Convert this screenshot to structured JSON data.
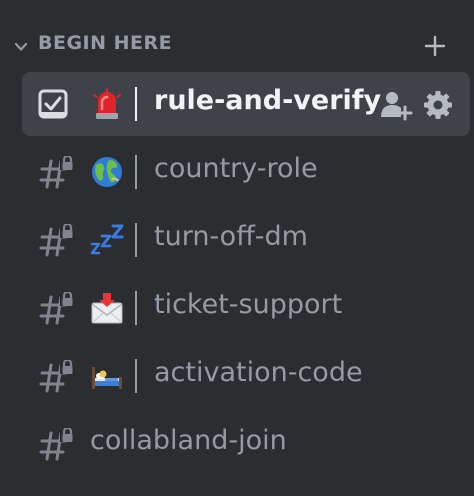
{
  "category": {
    "label": "BEGIN HERE"
  },
  "channels": [
    {
      "name": "rule-and-verify",
      "emoji": "police-light-emoji",
      "active": true
    },
    {
      "name": "country-role",
      "emoji": "globe-emoji",
      "active": false
    },
    {
      "name": "turn-off-dm",
      "emoji": "zzz-emoji",
      "active": false
    },
    {
      "name": "ticket-support",
      "emoji": "incoming-envelope-emoji",
      "active": false
    },
    {
      "name": "activation-code",
      "emoji": "bed-emoji",
      "active": false
    },
    {
      "name": "collabland-join",
      "emoji": "",
      "active": false
    }
  ],
  "colors": {
    "background": "#2b2d31",
    "active_row": "#404249",
    "muted_text": "#949ba4",
    "active_text": "#f2f3f5"
  }
}
